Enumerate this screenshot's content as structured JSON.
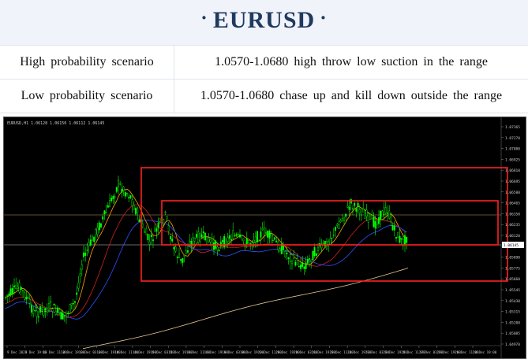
{
  "title": "EURUSD",
  "title_decoration": "·",
  "scenarios": [
    {
      "label": "High probability scenario",
      "text": "1.0570-1.0680  high  throw  low  suction  in  the  range"
    },
    {
      "label": "Low probability scenario",
      "text": "1.0570-1.0680  chase  up  and  kill  down  outside  the  range"
    }
  ],
  "chart": {
    "header": "EURUSD,H1  1.06128 1.06150 1.06112 1.06145",
    "price_labels": [
      "1.07365",
      "1.07270",
      "1.07080",
      "1.06925",
      "1.06810",
      "1.06695",
      "1.06580",
      "1.06465",
      "1.06350",
      "1.06235",
      "1.06120",
      "1.06005",
      "1.05890",
      "1.05775",
      "1.05660",
      "1.05545",
      "1.05430",
      "1.05315",
      "1.05200",
      "1.05085",
      "1.04970"
    ],
    "current_price": "1.06145",
    "time_labels": [
      "9 Dec 2022",
      "9 Dec 19:00",
      "12 Dec 11:00",
      "12 Dec 19:00",
      "13 Dec 03:00",
      "13 Dec 19:00",
      "14 Dec 11:00",
      "14 Dec 19:00",
      "15 Dec 03:00",
      "15 Dec 19:00",
      "16 Dec 11:00",
      "16 Dec 19:00",
      "19 Dec 03:00",
      "19 Dec 19:00",
      "20 Dec 11:00",
      "20 Dec 19:00",
      "21 Dec 03:00",
      "21 Dec 19:00",
      "22 Dec 11:00",
      "22 Dec 19:00",
      "23 Dec 03:00",
      "23 Dec 19:00",
      "26 Dec 11:00",
      "27 Dec 03:00",
      "27 Dec 19:00",
      "28 Dec 11:00",
      "28 Dec 19:00"
    ],
    "colors": {
      "candle": "#00ff00",
      "box": "#ff2020",
      "ma_orange": "#ffa500",
      "ma_red": "#d02020",
      "ma_blue": "#3050ff",
      "ma_gold": "#e8c890",
      "hline": "#b8a060",
      "grid": "#1a1a1a"
    }
  }
}
